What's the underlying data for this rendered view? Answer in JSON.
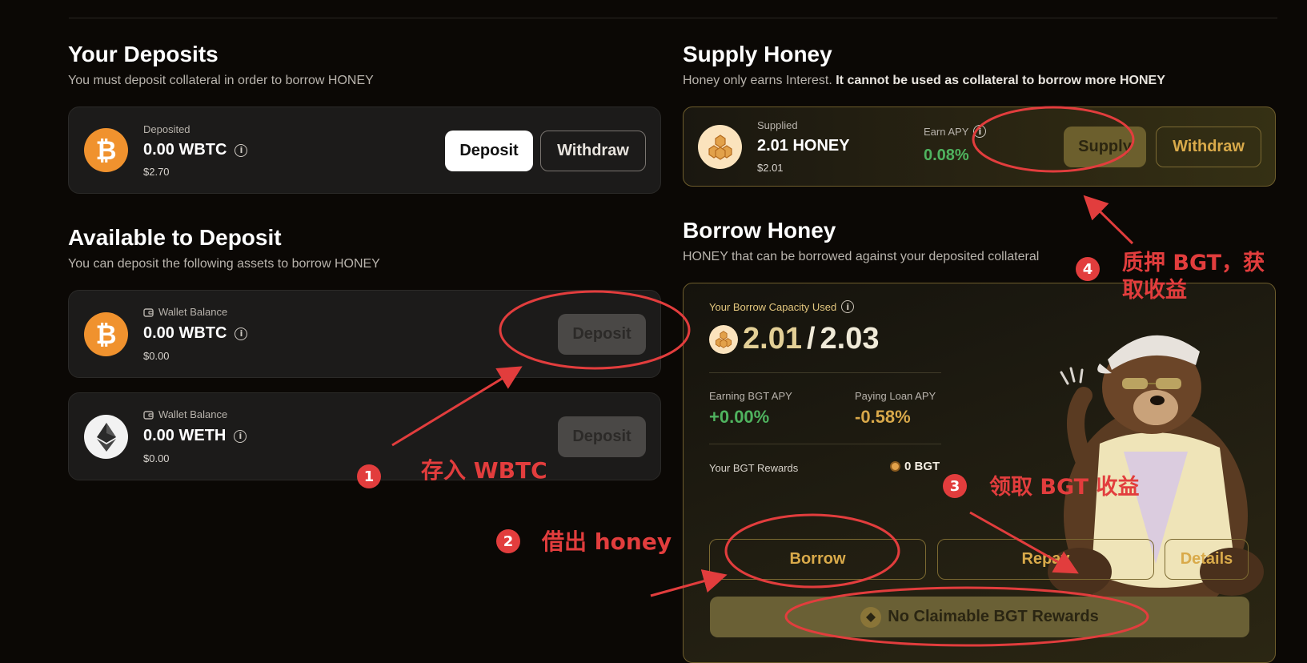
{
  "deposits": {
    "title": "Your Deposits",
    "subtitle": "You must deposit collateral in order to borrow HONEY",
    "card": {
      "label": "Deposited",
      "amount": "0.00 WBTC",
      "usd": "$2.70",
      "deposit_label": "Deposit",
      "withdraw_label": "Withdraw"
    }
  },
  "available": {
    "title": "Available to Deposit",
    "subtitle": "You can deposit the following assets to borrow HONEY",
    "items": [
      {
        "label": "Wallet Balance",
        "amount": "0.00 WBTC",
        "usd": "$0.00",
        "deposit_label": "Deposit"
      },
      {
        "label": "Wallet Balance",
        "amount": "0.00 WETH",
        "usd": "$0.00",
        "deposit_label": "Deposit"
      }
    ]
  },
  "supply": {
    "title": "Supply Honey",
    "subtitle_plain": "Honey only earns Interest. ",
    "subtitle_bold": "It cannot be used as collateral to borrow more HONEY",
    "card": {
      "label": "Supplied",
      "amount": "2.01 HONEY",
      "usd": "$2.01",
      "apy_label": "Earn APY",
      "apy_value": "0.08%",
      "supply_label": "Supply",
      "withdraw_label": "Withdraw"
    }
  },
  "borrow": {
    "title": "Borrow Honey",
    "subtitle": "HONEY that can be borrowed against your deposited collateral",
    "capacity_label": "Your Borrow Capacity Used",
    "capacity_used": "2.01",
    "capacity_sep": "/",
    "capacity_total": "2.03",
    "earning_label": "Earning BGT APY",
    "earning_value": "+0.00%",
    "paying_label": "Paying Loan APY",
    "paying_value": "-0.58%",
    "rewards_label": "Your BGT Rewards",
    "rewards_value": "0 BGT",
    "borrow_label": "Borrow",
    "repay_label": "Repay",
    "details_label": "Details",
    "claim_label": "No Claimable BGT Rewards"
  },
  "annotations": {
    "a1_num": "1",
    "a1_text": "存入 WBTC",
    "a2_num": "2",
    "a2_text": "借出 honey",
    "a3_num": "3",
    "a3_text": "领取 BGT 收益",
    "a4_num": "4",
    "a4_line1": "质押 BGT，获",
    "a4_line2": "取收益"
  },
  "colors": {
    "annotation_red": "#e23d3d",
    "gold_accent": "#e3c77e",
    "apy_green": "#4fb35f",
    "btc_orange": "#f0922e"
  },
  "icons": [
    "bitcoin-icon",
    "ethereum-icon",
    "honeycomb-icon",
    "info-icon",
    "wallet-icon",
    "bgt-token-icon",
    "bear-illustration"
  ]
}
